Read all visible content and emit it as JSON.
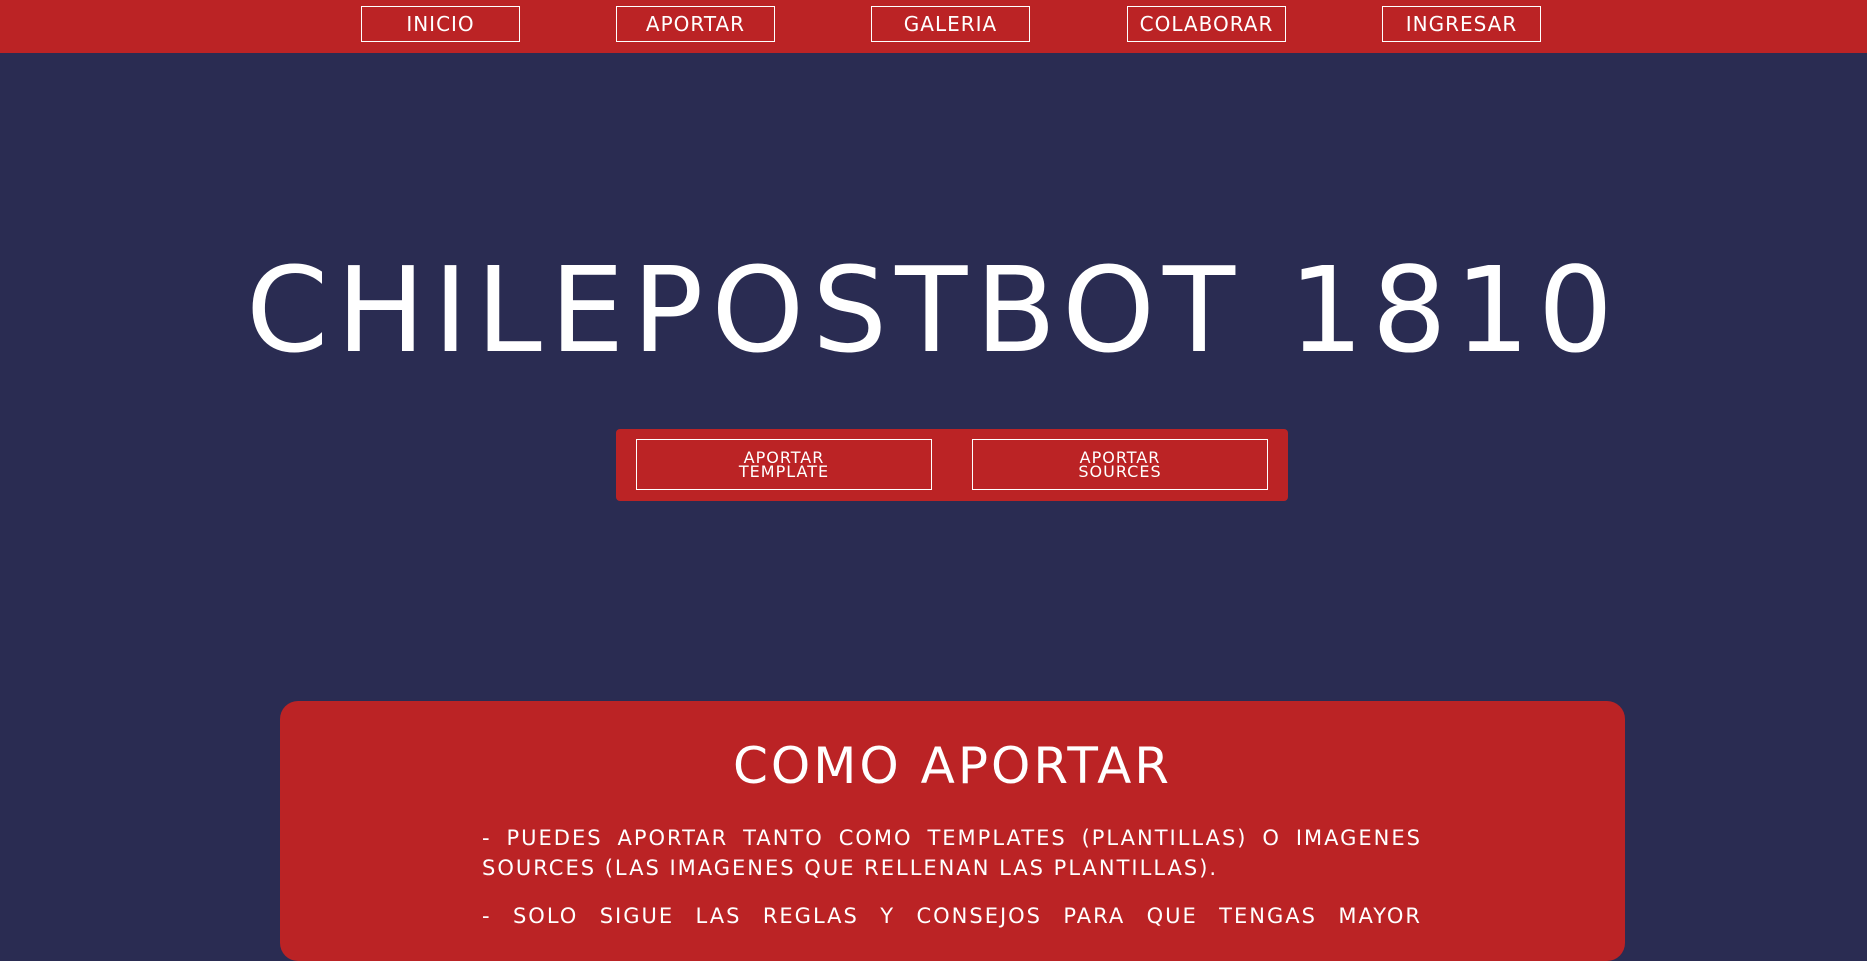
{
  "nav": {
    "items": [
      {
        "label": "INICIO"
      },
      {
        "label": "APORTAR"
      },
      {
        "label": "GALERIA"
      },
      {
        "label": "COLABORAR"
      },
      {
        "label": "INGRESAR"
      }
    ]
  },
  "hero": {
    "title": "CHILEPOSTBOT 1810",
    "buttons": [
      {
        "line1": "APORTAR",
        "line2": "TEMPLATE"
      },
      {
        "line1": "APORTAR",
        "line2": "SOURCES"
      }
    ]
  },
  "info": {
    "title": "COMO APORTAR",
    "paragraphs": [
      "- PUEDES APORTAR TANTO COMO TEMPLATES (PLANTILLAS) O IMAGENES SOURCES (LAS IMAGENES QUE RELLENAN LAS PLANTILLAS).",
      "- SOLO SIGUE LAS REGLAS Y CONSEJOS PARA QUE TENGAS MAYOR"
    ]
  },
  "colors": {
    "background": "#2a2c52",
    "accent": "#bb2325",
    "text": "#ffffff"
  }
}
